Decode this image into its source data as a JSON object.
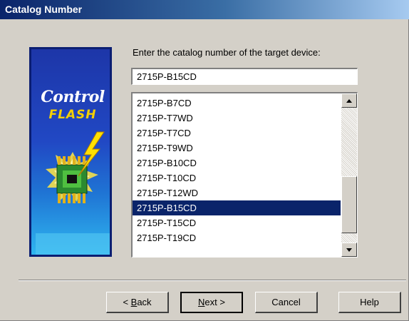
{
  "window": {
    "title": "Catalog Number"
  },
  "logo": {
    "line1": "Control",
    "line2": "FLASH"
  },
  "prompt": "Enter the catalog number of the target device:",
  "catalog_input": {
    "value": "2715P-B15CD"
  },
  "catalog_list": {
    "items": [
      "2715P-B7CD",
      "2715P-T7WD",
      "2715P-T7CD",
      "2715P-T9WD",
      "2715P-B10CD",
      "2715P-T10CD",
      "2715P-T12WD",
      "2715P-B15CD",
      "2715P-T15CD",
      "2715P-T19CD"
    ],
    "selected_index": 7
  },
  "buttons": {
    "back": {
      "prefix": "< ",
      "mnemonic": "B",
      "rest": "ack"
    },
    "next": {
      "mnemonic": "N",
      "rest": "ext >"
    },
    "cancel": "Cancel",
    "help": "Help"
  },
  "colors": {
    "selection": "#0a246a",
    "dialog_bg": "#d4d0c8",
    "title_bar": "#0a246a"
  }
}
